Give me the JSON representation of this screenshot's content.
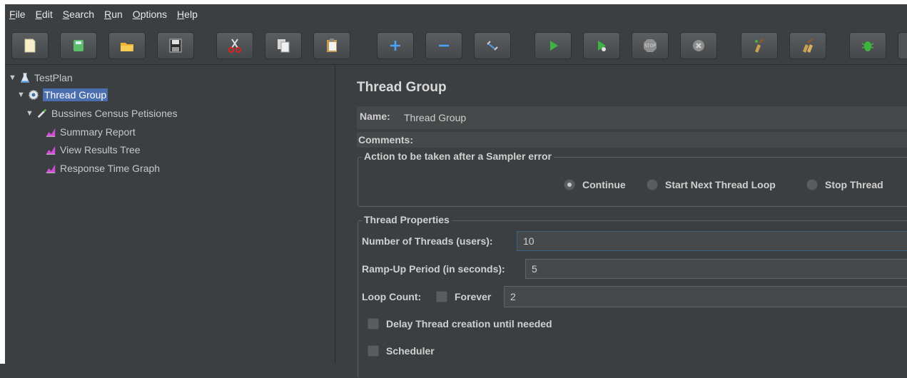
{
  "menu": [
    {
      "label": "File",
      "mnemonic": "F",
      "rest": "ile"
    },
    {
      "label": "Edit",
      "mnemonic": "E",
      "rest": "dit"
    },
    {
      "label": "Search",
      "mnemonic": "S",
      "rest": "earch"
    },
    {
      "label": "Run",
      "mnemonic": "R",
      "rest": "un"
    },
    {
      "label": "Options",
      "mnemonic": "O",
      "rest": "ptions"
    },
    {
      "label": "Help",
      "mnemonic": "H",
      "rest": "elp"
    }
  ],
  "toolbar_icons": [
    "new-icon",
    "templates-icon",
    "open-icon",
    "save-icon",
    "cut-icon",
    "copy-icon",
    "paste-icon",
    "expand-icon",
    "collapse-icon",
    "toggle-icon",
    "start-icon",
    "start-no-pause-icon",
    "stop-icon",
    "shutdown-icon",
    "clear-icon",
    "clear-all-icon",
    "search-bug-icon"
  ],
  "tree": {
    "items": [
      {
        "label": "TestPlan"
      },
      {
        "label": "Thread Group"
      },
      {
        "label": "Bussines Census Petisiones"
      },
      {
        "label": "Summary Report"
      },
      {
        "label": "View Results Tree"
      },
      {
        "label": "Response Time Graph"
      }
    ]
  },
  "panel": {
    "title": "Thread Group",
    "name_label": "Name:",
    "name_value": "Thread Group",
    "comments_label": "Comments:",
    "error_group_title": "Action to be taken after a Sampler error",
    "error_options": [
      "Continue",
      "Start Next Thread Loop",
      "Stop Thread"
    ],
    "selected_error_option": "Continue",
    "thread_props_title": "Thread Properties",
    "threads_label": "Number of Threads (users):",
    "threads_value": "10",
    "rampup_label": "Ramp-Up Period (in seconds):",
    "rampup_value": "5",
    "loop_label": "Loop Count:",
    "forever_label": "Forever",
    "loop_value": "2",
    "delay_label": "Delay Thread creation until needed",
    "scheduler_label": "Scheduler"
  },
  "colors": {
    "background": "#3c3f41",
    "selection": "#4b6eaf",
    "selection_row": "#0d293e",
    "run_green": "#3fb33f"
  }
}
